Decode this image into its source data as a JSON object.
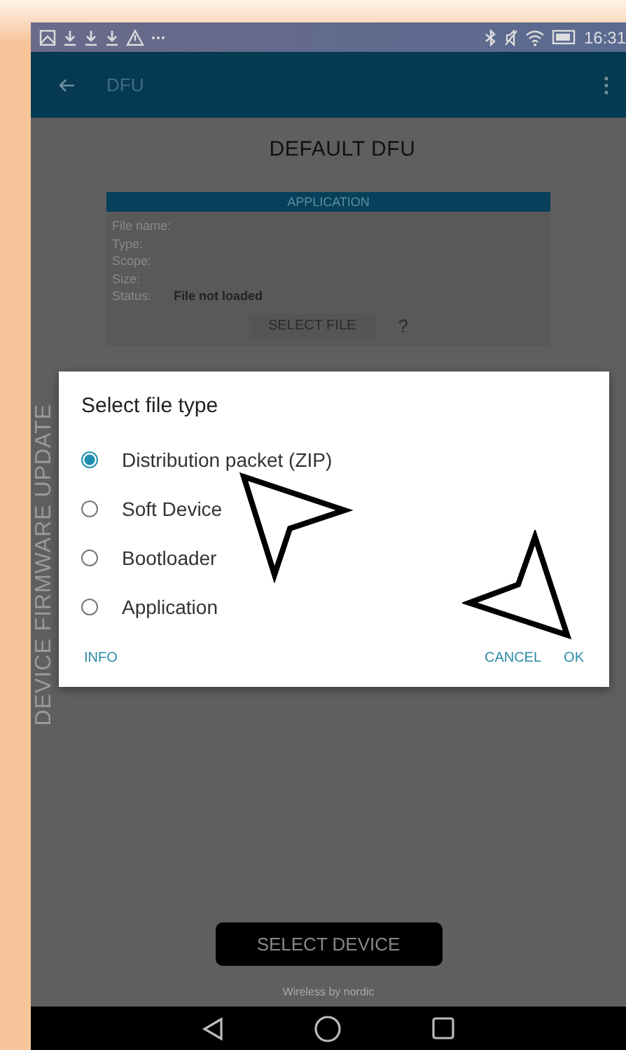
{
  "status_bar": {
    "time": "16:31"
  },
  "app_bar": {
    "title": "DFU"
  },
  "heading": "DEFAULT DFU",
  "side_label": "DEVICE FIRMWARE UPDATE",
  "card": {
    "title": "APPLICATION",
    "fields": [
      {
        "label": "File name:"
      },
      {
        "label": "Type:"
      },
      {
        "label": "Scope:"
      },
      {
        "label": "Size:"
      },
      {
        "label": "Status:",
        "value": "File not loaded"
      }
    ],
    "select_button": "SELECT FILE",
    "help": "?"
  },
  "dialog": {
    "title": "Select file type",
    "options": [
      {
        "label": "Distribution packet (ZIP)",
        "selected": true
      },
      {
        "label": "Soft Device",
        "selected": false
      },
      {
        "label": "Bootloader",
        "selected": false
      },
      {
        "label": "Application",
        "selected": false
      }
    ],
    "buttons": [
      {
        "label": "INFO",
        "kind": "left"
      },
      {
        "label": "CANCEL",
        "kind": "right"
      },
      {
        "label": "OK",
        "kind": "right"
      }
    ]
  },
  "select_device": "SELECT DEVICE",
  "footer": "Wireless by nordic"
}
